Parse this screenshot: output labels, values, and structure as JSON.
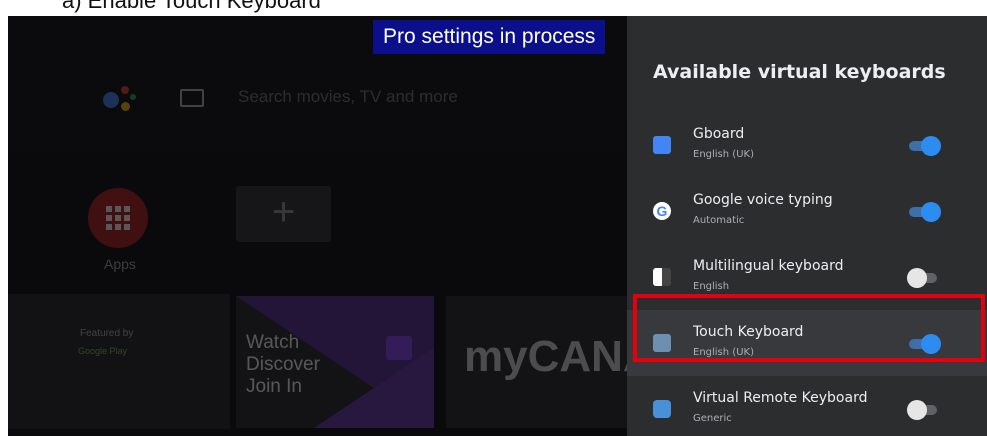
{
  "document": {
    "caption": "a)  Enable Touch Keyboard"
  },
  "launcher": {
    "search_placeholder": "Search movies, TV and more",
    "apps_label": "Apps",
    "featured_by": "Featured by",
    "google_play": "Google Play",
    "twitch_lines": [
      "Watch",
      "Discover",
      "Join In"
    ],
    "canal_logo": "myCANAL"
  },
  "banner": {
    "text": "Pro settings in process",
    "color": "#0b0f8c"
  },
  "panel": {
    "title": "Available virtual keyboards",
    "items": [
      {
        "name": "Gboard",
        "sub": "English (UK)",
        "icon": "gboard-icon",
        "enabled": true
      },
      {
        "name": "Google voice typing",
        "sub": "Automatic",
        "icon": "google-g-icon",
        "enabled": true
      },
      {
        "name": "Multilingual keyboard",
        "sub": "English",
        "icon": "multilingual-keyboard-icon",
        "enabled": false
      },
      {
        "name": "Touch Keyboard",
        "sub": "English (UK)",
        "icon": "touch-keyboard-icon",
        "enabled": true,
        "focused": true
      },
      {
        "name": "Virtual Remote Keyboard",
        "sub": "Generic",
        "icon": "virtual-remote-icon",
        "enabled": false
      }
    ]
  },
  "colors": {
    "toggle_on": "#2d8cf0",
    "highlight": "#e4000f",
    "panel_bg": "#2c2d2f"
  }
}
